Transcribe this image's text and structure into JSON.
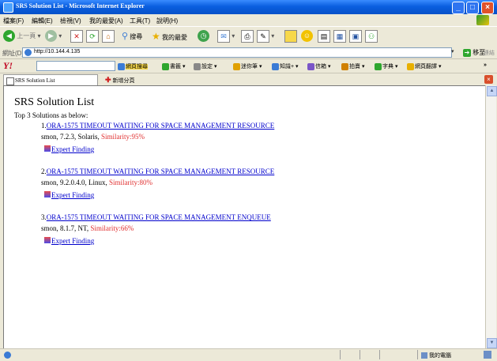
{
  "window": {
    "title": "SRS Solution List - Microsoft Internet Explorer"
  },
  "menu": [
    "檔案(F)",
    "編輯(E)",
    "檢視(V)",
    "我的最愛(A)",
    "工具(T)",
    "說明(H)"
  ],
  "toolbar": {
    "back_label": "上一頁",
    "search_label": "搜尋",
    "favorites_label": "我的最愛"
  },
  "address": {
    "label": "網址(D)",
    "url": "http://10.144.4.135",
    "go_label": "移至",
    "links_label": "連結"
  },
  "yahoo": {
    "items": [
      "網頁搜尋",
      "書籤",
      "設定",
      "迷你筆",
      "知識+",
      "信箱",
      "拍賣",
      "字典",
      "網頁翻譯"
    ]
  },
  "tabs": {
    "active": "SRS Solution List",
    "new_tab": "新增分頁"
  },
  "page": {
    "title": "SRS Solution List",
    "subtitle": "Top 3 Solutions as below:",
    "results": [
      {
        "index": "1.",
        "title": "ORA-1575 TIMEOUT WAITING FOR SPACE MANAGEMENT RESOURCE",
        "meta": "smon, 7.2.3, Solaris,",
        "similarity": "Similarity:95%",
        "link": "Expert Finding"
      },
      {
        "index": "2.",
        "title": "ORA-1575 TIMEOUT WAITING FOR SPACE MANAGEMENT RESOURCE",
        "meta": "smon, 9.2.0.4.0, Linux,",
        "similarity": "Similarity:80%",
        "link": "Expert Finding"
      },
      {
        "index": "3.",
        "title": "ORA-1575 TIMEOUT WAITING FOR SPACE MANAGEMENT ENQUEUE",
        "meta": "smon, 8.1.7, NT,",
        "similarity": "Similarity:66%",
        "link": "Expert Finding"
      }
    ]
  },
  "status": {
    "zone": "我的電腦"
  }
}
